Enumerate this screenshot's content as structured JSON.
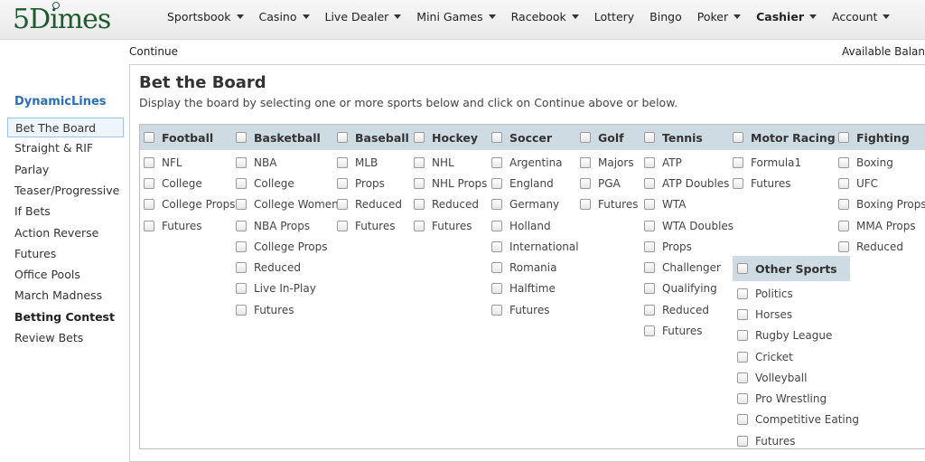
{
  "logo": {
    "text": "5Dimes"
  },
  "nav": [
    {
      "label": "Sportsbook",
      "dropdown": true,
      "bold": false
    },
    {
      "label": "Casino",
      "dropdown": true,
      "bold": false
    },
    {
      "label": "Live Dealer",
      "dropdown": true,
      "bold": false
    },
    {
      "label": "Mini Games",
      "dropdown": true,
      "bold": false
    },
    {
      "label": "Racebook",
      "dropdown": true,
      "bold": false
    },
    {
      "label": "Lottery",
      "dropdown": false,
      "bold": false
    },
    {
      "label": "Bingo",
      "dropdown": false,
      "bold": false
    },
    {
      "label": "Poker",
      "dropdown": true,
      "bold": false
    },
    {
      "label": "Cashier",
      "dropdown": true,
      "bold": true
    },
    {
      "label": "Account",
      "dropdown": true,
      "bold": false
    }
  ],
  "subbar": {
    "continue_label": "Continue",
    "balance_label": "Available Balanc"
  },
  "sidebar": {
    "title": "DynamicLines",
    "items": [
      {
        "label": "Bet The Board",
        "active": true,
        "bold": false
      },
      {
        "label": "Straight & RIF",
        "active": false,
        "bold": false
      },
      {
        "label": "Parlay",
        "active": false,
        "bold": false
      },
      {
        "label": "Teaser/Progressive",
        "active": false,
        "bold": false
      },
      {
        "label": "If Bets",
        "active": false,
        "bold": false
      },
      {
        "label": "Action Reverse",
        "active": false,
        "bold": false
      },
      {
        "label": "Futures",
        "active": false,
        "bold": false
      },
      {
        "label": "Office Pools",
        "active": false,
        "bold": false
      },
      {
        "label": "March Madness",
        "active": false,
        "bold": false
      },
      {
        "label": "Betting Contest",
        "active": false,
        "bold": true
      },
      {
        "label": "Review Bets",
        "active": false,
        "bold": false
      }
    ]
  },
  "main": {
    "title": "Bet the Board",
    "subtitle": "Display the board by selecting one or more sports below and click on Continue above or below."
  },
  "sports": [
    {
      "name": "Football",
      "options": [
        "NFL",
        "College",
        "College Props",
        "Futures"
      ]
    },
    {
      "name": "Basketball",
      "options": [
        "NBA",
        "College",
        "College Women",
        "NBA Props",
        "College Props",
        "Reduced",
        "Live In-Play",
        "Futures"
      ]
    },
    {
      "name": "Baseball",
      "options": [
        "MLB",
        "Props",
        "Reduced",
        "Futures"
      ]
    },
    {
      "name": "Hockey",
      "options": [
        "NHL",
        "NHL Props",
        "Reduced",
        "Futures"
      ]
    },
    {
      "name": "Soccer",
      "options": [
        "Argentina",
        "England",
        "Germany",
        "Holland",
        "International",
        "Romania",
        "Halftime",
        "Futures"
      ]
    },
    {
      "name": "Golf",
      "options": [
        "Majors",
        "PGA",
        "Futures"
      ]
    },
    {
      "name": "Tennis",
      "options": [
        "ATP",
        "ATP Doubles",
        "WTA",
        "WTA Doubles",
        "Props",
        "Challenger",
        "Qualifying",
        "Reduced",
        "Futures"
      ]
    },
    {
      "name": "Motor Racing",
      "options": [
        "Formula1",
        "Futures"
      ]
    },
    {
      "name": "Fighting",
      "options": [
        "Boxing",
        "UFC",
        "Boxing Props",
        "MMA Props",
        "Reduced"
      ]
    }
  ],
  "other_sports": {
    "name": "Other Sports",
    "options": [
      "Politics",
      "Horses",
      "Rugby League",
      "Cricket",
      "Volleyball",
      "Pro Wrestling",
      "Competitive Eating",
      "Futures"
    ]
  }
}
